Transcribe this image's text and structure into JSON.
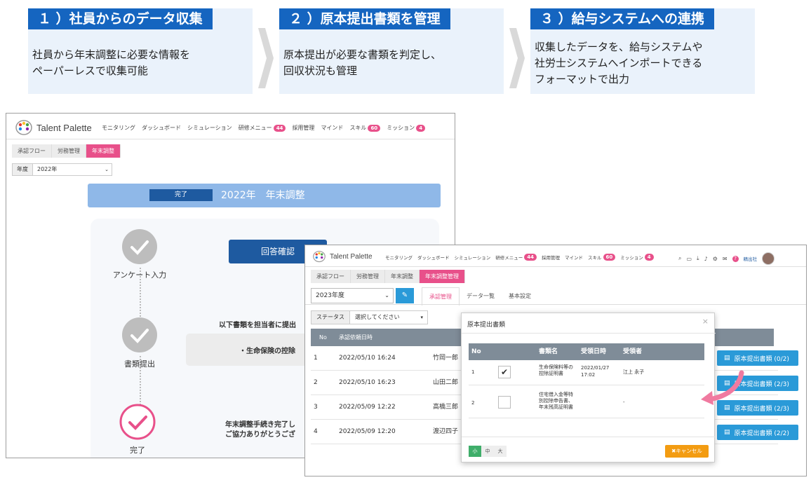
{
  "steps": [
    {
      "title": "１ ）社員からのデータ収集",
      "desc": "社員から年末調整に必要な情報を\nペーパーレスで収集可能"
    },
    {
      "title": "２ ）原本提出書類を管理",
      "desc": "原本提出が必要な書類を判定し、\n回収状況も管理"
    },
    {
      "title": "３ ）給与システムへの連携",
      "desc": "収集したデータを、給与システムや\n社労士システムへインポートできる\nフォーマットで出力"
    }
  ],
  "brand": "Talent Palette",
  "nav": [
    {
      "label": "モニタリング"
    },
    {
      "label": "ダッシュボード"
    },
    {
      "label": "シミュレーション"
    },
    {
      "label": "研修メニュー",
      "badge": "44"
    },
    {
      "label": "採用管理"
    },
    {
      "label": "マインド"
    },
    {
      "label": "スキル",
      "badge": "60"
    },
    {
      "label": "ミッション",
      "badge": "4"
    }
  ],
  "win1": {
    "tabs": [
      "承認フロー",
      "労務管理",
      "年末調整"
    ],
    "year_label": "年度",
    "year_value": "2022年",
    "status_badge": "完了",
    "banner_title": "2022年　年末調整",
    "steps": [
      "アンケート入力",
      "書類提出",
      "完了"
    ],
    "confirm_button": "回答確認",
    "msg1": "以下書類を担当者に提出",
    "doc_item": "・生命保険の控除",
    "msg2a": "年末調整手続き完了し",
    "msg2b": "ご協力ありがとうござ"
  },
  "win2": {
    "tabs": [
      "承認フロー",
      "労務管理",
      "年末調整",
      "年末調整管理"
    ],
    "year_value": "2023年度",
    "sub_tabs": [
      "承認管理",
      "データ一覧",
      "基本設定"
    ],
    "status_label": "ステータス",
    "status_placeholder": "選択してください",
    "header_no": "No",
    "header_date": "承認依頼日時",
    "rows": [
      {
        "no": "1",
        "date": "2022/05/10 16:24",
        "name": "竹岡一郎"
      },
      {
        "no": "2",
        "date": "2022/05/10 16:23",
        "name": "山田二郎"
      },
      {
        "no": "3",
        "date": "2022/05/09 12:22",
        "name": "高橋三郎"
      },
      {
        "no": "4",
        "date": "2022/05/09 12:20",
        "name": "渡辺四子"
      }
    ],
    "doc_buttons": [
      "原本提出書類 (0/2)",
      "原本提出書類 (2/3)",
      "原本提出書類 (2/3)",
      "原本提出書類 (2/2)"
    ],
    "user_label": "精出社"
  },
  "modal": {
    "title": "原本提出書類",
    "headers": [
      "No",
      "書類名",
      "受領日時",
      "受領者"
    ],
    "rows": [
      {
        "no": "1",
        "checked": true,
        "doc": "生命保険料等の\n控除証明書",
        "date": "2022/01/27\n17:02",
        "receiver": "江上 永子"
      },
      {
        "no": "2",
        "checked": false,
        "doc": "住宅借入金等特\n別控除申告書、\n年末残高証明書",
        "date": "",
        "receiver": "-"
      }
    ],
    "sizes": [
      "小",
      "中",
      "大"
    ],
    "cancel": "✖キャンセル"
  },
  "colors": {
    "step_blue": "#1565c0",
    "pink": "#e8508a",
    "accent": "#2a9ad8"
  }
}
